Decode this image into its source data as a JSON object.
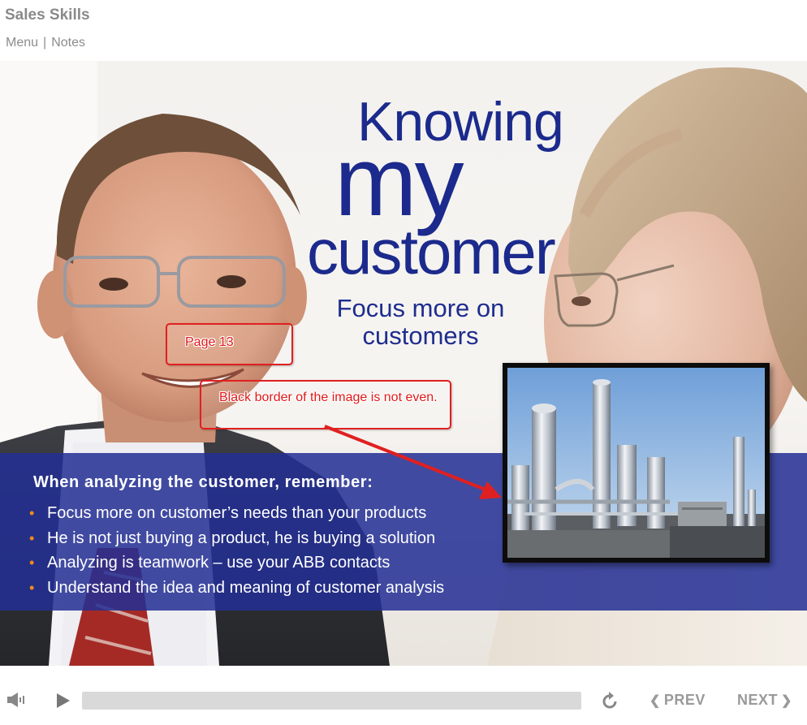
{
  "app": {
    "title": "Sales Skills"
  },
  "nav": {
    "menu_label": "Menu",
    "separator": "|",
    "notes_label": "Notes"
  },
  "slide": {
    "title_line1": "Knowing",
    "title_line2": "my",
    "title_line3": "customer",
    "subtitle": "Focus more on customers",
    "band_heading": "When analyzing the customer, remember:",
    "bullet_marker": "•",
    "bullets": [
      "Focus more on customer’s needs than your products",
      "He is not just buying a product, he is buying a solution",
      "Analyzing is teamwork – use your ABB contacts",
      "Understand the idea and meaning of customer analysis"
    ],
    "accent_color": "#1b2a8c",
    "bullet_color": "#f08a1c"
  },
  "annotations": {
    "page_note": "Page 13",
    "border_note": "Black border of the image is not even.",
    "color": "#e02020"
  },
  "player": {
    "prev_label": "PREV",
    "next_label": "NEXT",
    "icons": [
      "volume-icon",
      "play-icon",
      "replay-icon",
      "chevron-left-icon",
      "chevron-right-icon"
    ],
    "progress": 0
  }
}
